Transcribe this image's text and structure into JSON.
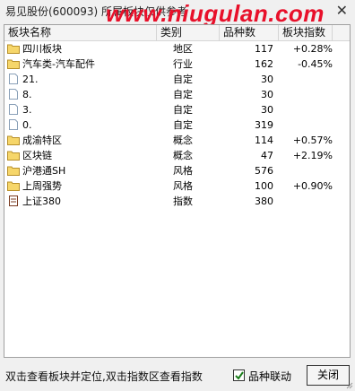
{
  "window": {
    "title": "易见股份(600093)  所属板块仅供参考",
    "close_glyph": "✕",
    "watermark": "www.niugulan.com"
  },
  "table": {
    "columns": [
      "板块名称",
      "类别",
      "品种数",
      "板块指数"
    ],
    "rows": [
      {
        "icon": "folder",
        "name": "四川板块",
        "type": "地区",
        "count": "117",
        "index": "+0.28%"
      },
      {
        "icon": "folder",
        "name": "汽车类-汽车配件",
        "type": "行业",
        "count": "162",
        "index": "-0.45%"
      },
      {
        "icon": "document",
        "name": "21.",
        "type": "自定",
        "count": "30",
        "index": ""
      },
      {
        "icon": "document",
        "name": "8.",
        "type": "自定",
        "count": "30",
        "index": ""
      },
      {
        "icon": "document",
        "name": "3.",
        "type": "自定",
        "count": "30",
        "index": ""
      },
      {
        "icon": "document",
        "name": "0.",
        "type": "自定",
        "count": "319",
        "index": ""
      },
      {
        "icon": "folder-solid",
        "name": "成渝特区",
        "type": "概念",
        "count": "114",
        "index": "+0.57%"
      },
      {
        "icon": "folder-solid",
        "name": "区块链",
        "type": "概念",
        "count": "47",
        "index": "+2.19%"
      },
      {
        "icon": "folder",
        "name": "沪港通SH",
        "type": "风格",
        "count": "576",
        "index": ""
      },
      {
        "icon": "folder",
        "name": "上周强势",
        "type": "风格",
        "count": "100",
        "index": "+0.90%"
      },
      {
        "icon": "index-doc",
        "name": "上证380",
        "type": "指数",
        "count": "380",
        "index": ""
      }
    ]
  },
  "footer": {
    "hint": "双击查看板块并定位,双击指数区查看指数",
    "checkbox_label": "品种联动",
    "checkbox_checked": true,
    "close_button": "关闭"
  },
  "colors": {
    "watermark": "#e8102a",
    "folder": "#f6d66a",
    "folder_border": "#b8902a"
  }
}
